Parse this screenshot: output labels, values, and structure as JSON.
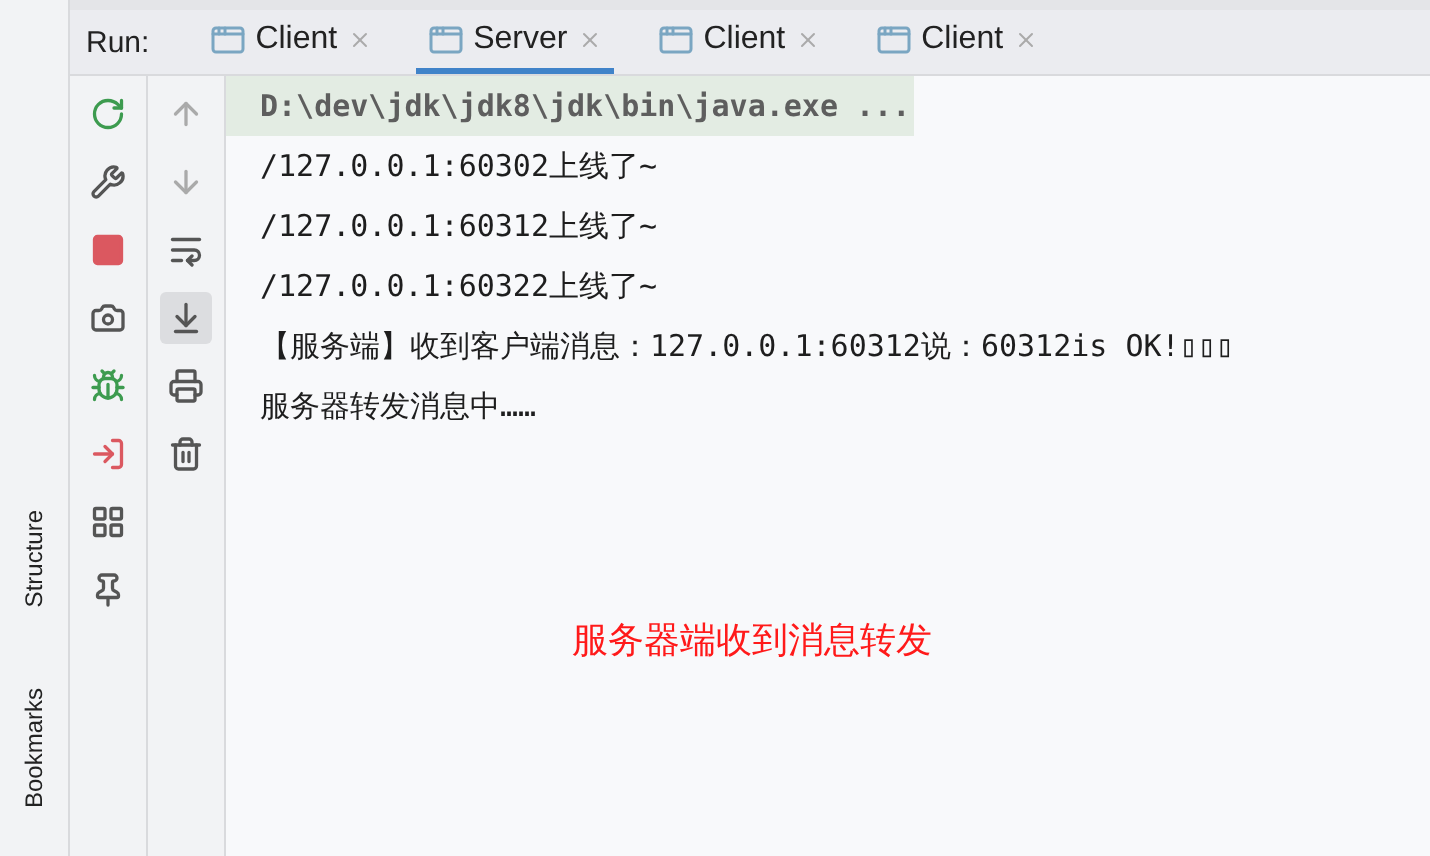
{
  "run_panel": {
    "label": "Run:",
    "tabs": [
      {
        "label": "Client",
        "selected": false
      },
      {
        "label": "Server",
        "selected": true
      },
      {
        "label": "Client",
        "selected": false
      },
      {
        "label": "Client",
        "selected": false
      }
    ]
  },
  "side_stripe": [
    {
      "label": "Structure"
    },
    {
      "label": "Bookmarks"
    }
  ],
  "toolbar_left": [
    {
      "kind": "rerun"
    },
    {
      "kind": "wrench"
    },
    {
      "kind": "stop"
    },
    {
      "kind": "camera"
    },
    {
      "kind": "bug"
    },
    {
      "kind": "login"
    },
    {
      "kind": "layout"
    },
    {
      "kind": "pin"
    }
  ],
  "toolbar_right": [
    {
      "kind": "up",
      "selected": false
    },
    {
      "kind": "down",
      "selected": false
    },
    {
      "kind": "wrap",
      "selected": false
    },
    {
      "kind": "scroll_end",
      "selected": true
    },
    {
      "kind": "print",
      "selected": false
    },
    {
      "kind": "trash",
      "selected": false
    }
  ],
  "console": [
    {
      "kind": "command",
      "text": "D:\\dev\\jdk\\jdk8\\jdk\\bin\\java.exe ..."
    },
    {
      "kind": "output",
      "text": "/127.0.0.1:60302上线了~"
    },
    {
      "kind": "output",
      "text": "/127.0.0.1:60312上线了~"
    },
    {
      "kind": "output",
      "text": "/127.0.0.1:60322上线了~"
    },
    {
      "kind": "output",
      "text": "【服务端】收到客户端消息：127.0.0.1:60312说：60312is OK!▯▯▯"
    },
    {
      "kind": "output",
      "text": "服务器转发消息中……"
    }
  ],
  "annotation": "服务器端收到消息转发"
}
